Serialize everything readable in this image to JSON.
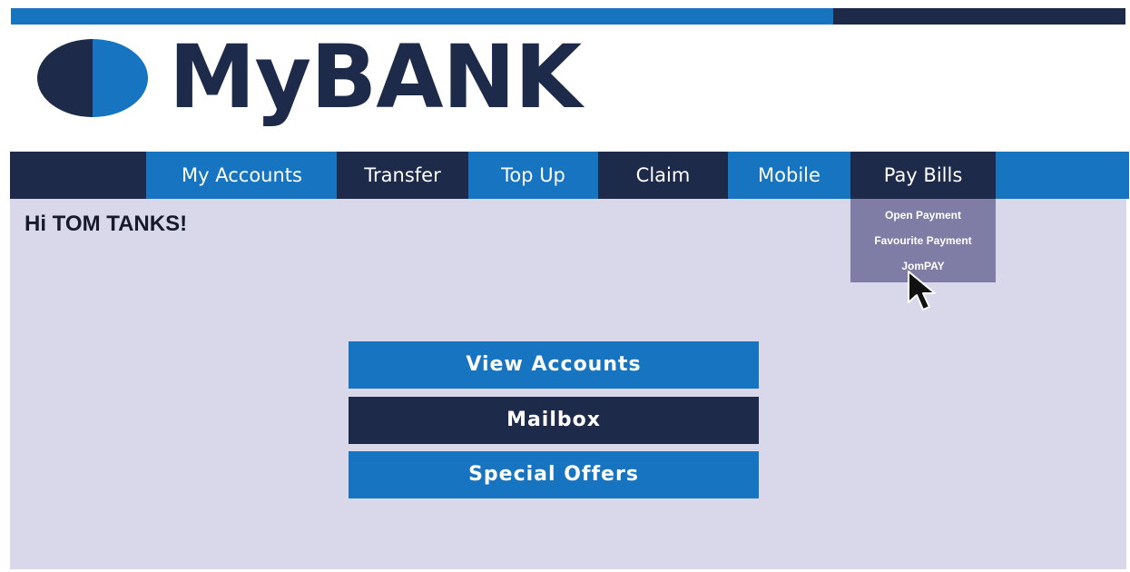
{
  "brand": {
    "name": "MyBANK",
    "colors": {
      "primary_blue": "#1674c0",
      "dark_navy": "#1d2a4a",
      "content_bg": "#d8d8ea",
      "dropdown_bg": "#7f7ca6"
    },
    "logo_icon": "half-circle-logo-icon"
  },
  "nav": {
    "items": [
      {
        "label": "My Accounts"
      },
      {
        "label": "Transfer"
      },
      {
        "label": "Top Up"
      },
      {
        "label": "Claim"
      },
      {
        "label": "Mobile"
      },
      {
        "label": "Pay Bills"
      }
    ],
    "active": "Pay Bills"
  },
  "dropdown": {
    "items": [
      {
        "label": "Open Payment"
      },
      {
        "label": "Favourite Payment"
      },
      {
        "label": "JomPAY"
      }
    ]
  },
  "greeting": "Hi TOM TANKS!",
  "actions": {
    "view_accounts": "View Accounts",
    "mailbox": "Mailbox",
    "special_offers": "Special Offers"
  },
  "cursor_icon": "mouse-pointer-icon"
}
